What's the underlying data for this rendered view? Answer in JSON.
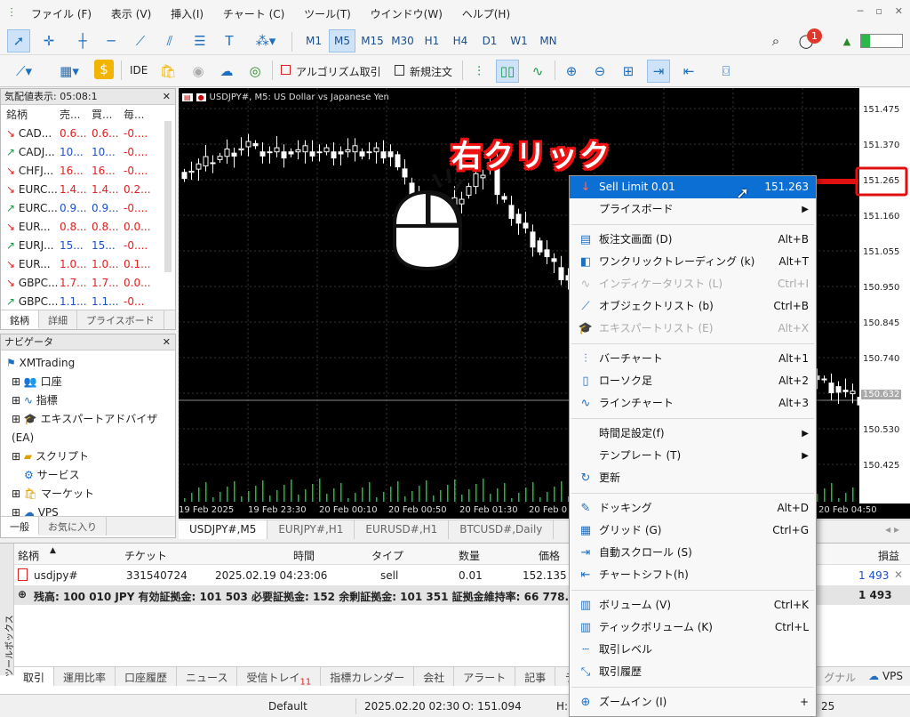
{
  "menubar": {
    "items": [
      "ファイル (F)",
      "表示 (V)",
      "挿入(I)",
      "チャート (C)",
      "ツール(T)",
      "ウインドウ(W)",
      "ヘルプ(H)"
    ]
  },
  "toolbar": {
    "timeframes": [
      "M1",
      "M5",
      "M15",
      "M30",
      "H1",
      "H4",
      "D1",
      "W1",
      "MN"
    ],
    "selected_timeframe": "M5",
    "notification_count": "1",
    "ide_label": "IDE",
    "algo_label": "アルゴリズム取引",
    "new_order_label": "新規注文"
  },
  "market_watch": {
    "title": "気配値表示: 05:08:1",
    "columns": [
      "銘柄",
      "売...",
      "買...",
      "毎..."
    ],
    "rows": [
      {
        "symbol": "CAD...",
        "bid": "0.6...",
        "ask": "0.6...",
        "chg": "-0....",
        "dir": "down"
      },
      {
        "symbol": "CADJ...",
        "bid": "10...",
        "ask": "10...",
        "chg": "-0....",
        "dir": "up"
      },
      {
        "symbol": "CHFJ...",
        "bid": "16...",
        "ask": "16...",
        "chg": "-0....",
        "dir": "down"
      },
      {
        "symbol": "EURC...",
        "bid": "1.4...",
        "ask": "1.4...",
        "chg": "0.2...",
        "dir": "down"
      },
      {
        "symbol": "EURC...",
        "bid": "0.9...",
        "ask": "0.9...",
        "chg": "-0....",
        "dir": "up"
      },
      {
        "symbol": "EUR...",
        "bid": "0.8...",
        "ask": "0.8...",
        "chg": "0.0...",
        "dir": "down"
      },
      {
        "symbol": "EURJ...",
        "bid": "15...",
        "ask": "15...",
        "chg": "-0....",
        "dir": "up"
      },
      {
        "symbol": "EUR...",
        "bid": "1.0...",
        "ask": "1.0...",
        "chg": "0.1...",
        "dir": "down"
      },
      {
        "symbol": "GBPC...",
        "bid": "1.7...",
        "ask": "1.7...",
        "chg": "0.0...",
        "dir": "down"
      },
      {
        "symbol": "GBPC...",
        "bid": "1.1...",
        "ask": "1.1...",
        "chg": "-0...",
        "dir": "up"
      }
    ],
    "tabs": [
      "銘柄",
      "詳細",
      "プライスボード"
    ]
  },
  "navigator": {
    "title": "ナビゲータ",
    "root": "XMTrading",
    "items": [
      "口座",
      "指標",
      "エキスパートアドバイザ(EA)",
      "スクリプト",
      "サービス",
      "マーケット",
      "VPS"
    ],
    "tabs": [
      "一般",
      "お気に入り"
    ]
  },
  "chart": {
    "title": "USDJPY#, M5:  US Dollar vs Japanese Yen",
    "price_labels": [
      "151.475",
      "151.370",
      "151.265",
      "151.160",
      "151.055",
      "150.950",
      "150.845",
      "150.740",
      "150.632",
      "150.530",
      "150.425"
    ],
    "time_labels": [
      "19 Feb 2025",
      "19 Feb 23:30",
      "20 Feb 00:10",
      "20 Feb 00:50",
      "20 Feb 01:30",
      "20 Feb 0",
      "20 Feb 04:50"
    ],
    "tabs": [
      "USDJPY#,M5",
      "EURJPY#,H1",
      "EURUSD#,H1",
      "BTCUSD#,Daily"
    ],
    "annotation": "右クリック"
  },
  "context_menu": {
    "items": [
      {
        "label": "Sell Limit 0.01",
        "shortcut": "151.263",
        "icon": "down-arrow-icon",
        "state": "highlight"
      },
      {
        "label": "プライスボード",
        "submenu": true
      },
      {
        "sep": true
      },
      {
        "label": "板注文画面 (D)",
        "shortcut": "Alt+B",
        "icon": "dom-icon"
      },
      {
        "label": "ワンクリックトレーディング (k)",
        "shortcut": "Alt+T",
        "icon": "oneclick-icon"
      },
      {
        "label": "インディケータリスト (L)",
        "shortcut": "Ctrl+I",
        "icon": "indicator-icon",
        "state": "disabled"
      },
      {
        "label": "オブジェクトリスト (b)",
        "shortcut": "Ctrl+B",
        "icon": "objects-icon"
      },
      {
        "label": "エキスパートリスト (E)",
        "shortcut": "Alt+X",
        "icon": "expert-icon",
        "state": "disabled"
      },
      {
        "sep": true
      },
      {
        "label": "バーチャート",
        "shortcut": "Alt+1",
        "icon": "bar-chart-icon"
      },
      {
        "label": "ローソク足",
        "shortcut": "Alt+2",
        "icon": "candle-icon"
      },
      {
        "label": "ラインチャート",
        "shortcut": "Alt+3",
        "icon": "line-chart-icon"
      },
      {
        "sep": true
      },
      {
        "label": "時間足設定(f)",
        "submenu": true
      },
      {
        "label": "テンプレート (T)",
        "submenu": true
      },
      {
        "label": "更新",
        "icon": "refresh-icon"
      },
      {
        "sep": true
      },
      {
        "label": "ドッキング",
        "shortcut": "Alt+D",
        "icon": "pin-icon"
      },
      {
        "label": "グリッド (G)",
        "shortcut": "Ctrl+G",
        "icon": "grid-icon"
      },
      {
        "label": "自動スクロール (S)",
        "icon": "autoscroll-icon"
      },
      {
        "label": "チャートシフト(h)",
        "icon": "chartshift-icon"
      },
      {
        "sep": true
      },
      {
        "label": "ボリューム (V)",
        "shortcut": "Ctrl+K",
        "icon": "volume-icon"
      },
      {
        "label": "ティックボリューム (K)",
        "shortcut": "Ctrl+L",
        "icon": "tickvolume-icon"
      },
      {
        "label": "取引レベル",
        "icon": "tradelevels-icon"
      },
      {
        "label": "取引履歴",
        "icon": "history-icon"
      },
      {
        "sep": true
      },
      {
        "label": "ズームイン (I)",
        "shortcut": "+",
        "icon": "zoom-in-icon"
      }
    ]
  },
  "terminal": {
    "side_label": "ツールボックス",
    "columns": [
      "銘柄",
      "チケット",
      "時間",
      "タイプ",
      "数量",
      "価格",
      "損益"
    ],
    "position": {
      "symbol": "usdjpy#",
      "ticket": "331540724",
      "time": "2025.02.19 04:23:06",
      "type": "sell",
      "volume": "0.01",
      "price": "152.135",
      "profit": "1 493"
    },
    "summary": "残高: 100 010 JPY  有効証拠金: 101 503  必要証拠金: 152  余剰証拠金: 101 351  証拠金維持率: 66 778.29 %",
    "summary_profit": "1 493",
    "tabs": [
      "取引",
      "運用比率",
      "口座履歴",
      "ニュース",
      "受信トレイ",
      "カレンダー",
      "アラート",
      "シグナル",
      "VPS"
    ],
    "tabs_labels": {
      "trade": "取引",
      "exposure": "運用比率",
      "history": "口座履歴",
      "news": "ニュース",
      "mailbox": "受信トレイ",
      "mail_count": "11",
      "calendar": "指標カレンダー",
      "company": "会社",
      "alerts": "アラート",
      "articles": "記事",
      "library": "ライ",
      "signals": "グナル",
      "vps": "VPS"
    }
  },
  "statusbar": {
    "profile": "Default",
    "datetime": "2025.02.20 02:30",
    "open": "O: 151.094",
    "high": "H: 15",
    "right": "25"
  },
  "colors": {
    "accent": "#0b6fd4",
    "annotation_red": "#e01010",
    "buy": "#1a9a4a",
    "sell": "#d22222"
  }
}
